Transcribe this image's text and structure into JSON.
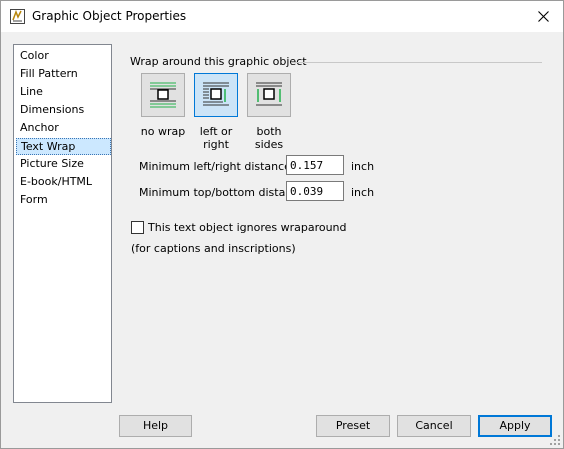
{
  "window": {
    "title": "Graphic Object Properties"
  },
  "sidebar": {
    "items": [
      {
        "label": "Color"
      },
      {
        "label": "Fill Pattern"
      },
      {
        "label": "Line"
      },
      {
        "label": "Dimensions"
      },
      {
        "label": "Anchor"
      },
      {
        "label": "Text Wrap",
        "selected": true
      },
      {
        "label": "Picture Size"
      },
      {
        "label": "E-book/HTML"
      },
      {
        "label": "Form"
      }
    ]
  },
  "wrap": {
    "legend": "Wrap around this graphic object",
    "options": [
      {
        "line1": "no wrap",
        "line2": "",
        "icon": "no-wrap-icon"
      },
      {
        "line1": "left or",
        "line2": "right",
        "icon": "left-or-right-icon",
        "selected": true
      },
      {
        "line1": "both",
        "line2": "sides",
        "icon": "both-sides-icon"
      }
    ]
  },
  "distances": {
    "left_right_label": "Minimum left/right distance",
    "left_right_value": "0.157",
    "top_bottom_label": "Minimum top/bottom distance",
    "top_bottom_value": "0.039",
    "unit": "inch"
  },
  "ignore_wrap": {
    "label": "This text object ignores wraparound",
    "checked": false,
    "note": "(for captions and inscriptions)"
  },
  "buttons": {
    "help": "Help",
    "preset": "Preset",
    "cancel": "Cancel",
    "apply": "Apply"
  },
  "colors": {
    "accent": "#0078d7",
    "selection": "#cce8ff",
    "icon_green": "#22b14c"
  }
}
